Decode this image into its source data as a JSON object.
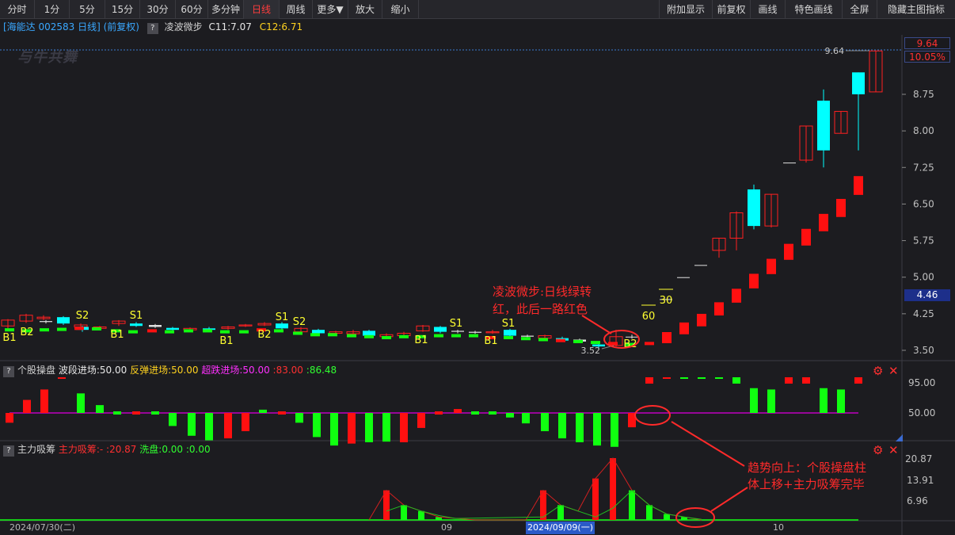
{
  "toolbar": {
    "left": [
      "分时",
      "1分",
      "5分",
      "15分",
      "30分",
      "60分",
      "多分钟",
      "日线",
      "周线",
      "更多▼",
      "放大",
      "缩小"
    ],
    "active": "日线",
    "right": [
      "附加显示",
      "前复权",
      "画线",
      "特色画线",
      "全屏",
      "隐藏主图指标"
    ]
  },
  "info": {
    "title": "[海能达 002583 日线] (前复权)",
    "help": "?",
    "indicator": "凌波微步",
    "c11": "C11:7.07",
    "c12": "C12:6.71"
  },
  "watermark": "与牛共舞",
  "price_axis": {
    "ticks": [
      "8.75",
      "8.00",
      "7.25",
      "6.50",
      "5.75",
      "5.00",
      "4.25",
      "3.50"
    ],
    "tick_values": [
      8.75,
      8.0,
      7.25,
      6.5,
      5.75,
      5.0,
      4.25,
      3.5
    ],
    "high_tag": "9.64",
    "pct_tag": "10.05%",
    "current_tag": "4.46",
    "high_label": "9.64",
    "low_label": "3.52"
  },
  "signals": {
    "buy_labels": [
      "B1",
      "B2",
      "B1",
      "B1",
      "B2",
      "B1",
      "B1",
      "B2"
    ],
    "sell_labels": [
      "S2",
      "S1",
      "S1",
      "S2",
      "S1",
      "S1"
    ],
    "markers": [
      "30",
      "60"
    ]
  },
  "panel1": {
    "help": "?",
    "name": "个股操盘",
    "l1": "波段进场:50.00",
    "l2": "反弹进场:50.00",
    "l3": "超跌进场:50.00",
    "l4": ":83.00",
    "l5": ":86.48",
    "ticks": [
      "95.00",
      "50.00"
    ]
  },
  "panel2": {
    "help": "?",
    "name": "主力吸筹",
    "l1": "主力吸筹:-",
    "l1b": ":20.87",
    "l2": "洗盘:0.00",
    "l3": ":0.00",
    "ticks": [
      "20.87",
      "13.91",
      "6.96"
    ]
  },
  "annotations": {
    "a1_line1": "凌波微步:日线绿转",
    "a1_line2": "红，此后一路红色",
    "a2_line1": "趋势向上：个股操盘柱",
    "a2_line2": "体上移+主力吸筹完毕"
  },
  "dates": {
    "d1": "2024/07/30(二)",
    "d2": "09",
    "d3": "2024/09/09(一)",
    "d4": "10"
  },
  "colors": {
    "up": "#ff2020",
    "down": "#00ffff",
    "ind_green": "#10ff10",
    "ind_red": "#ff1010",
    "purple": "#c000c0",
    "accent": "#3aa8ff"
  },
  "icons": {
    "gear": "gear-icon",
    "close": "close-icon",
    "triangle": "resize-triangle-icon"
  }
}
